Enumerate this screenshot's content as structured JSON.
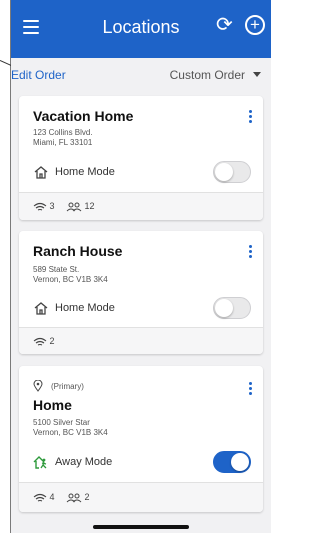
{
  "header": {
    "title": "Locations",
    "menu_icon": "hamburger-menu-icon",
    "refresh_icon": "refresh-icon",
    "add_icon": "plus-circle-icon",
    "color": "#1E63C8"
  },
  "toolbar": {
    "edit_order": "Edit Order",
    "sort_value": "Custom Order"
  },
  "locations": [
    {
      "name": "Vacation Home",
      "address_line1": "123 Collins Blvd.",
      "address_line2": "Miami, FL 33101",
      "mode": "Home Mode",
      "mode_icon": "home-icon",
      "toggle_on": false,
      "wifi_count": "3",
      "people_count": "12"
    },
    {
      "name": "Ranch House",
      "address_line1": "589 State St.",
      "address_line2": "Vernon, BC V1B 3K4",
      "mode": "Home Mode",
      "mode_icon": "home-icon",
      "toggle_on": false,
      "wifi_count": "2"
    },
    {
      "primary_label": "(Primary)",
      "name": "Home",
      "address_line1": "5100 Silver Star",
      "address_line2": "Vernon, BC V1B 3K4",
      "mode": "Away Mode",
      "mode_icon": "away-mode-icon",
      "toggle_on": true,
      "wifi_count": "4",
      "people_count": "2"
    }
  ]
}
